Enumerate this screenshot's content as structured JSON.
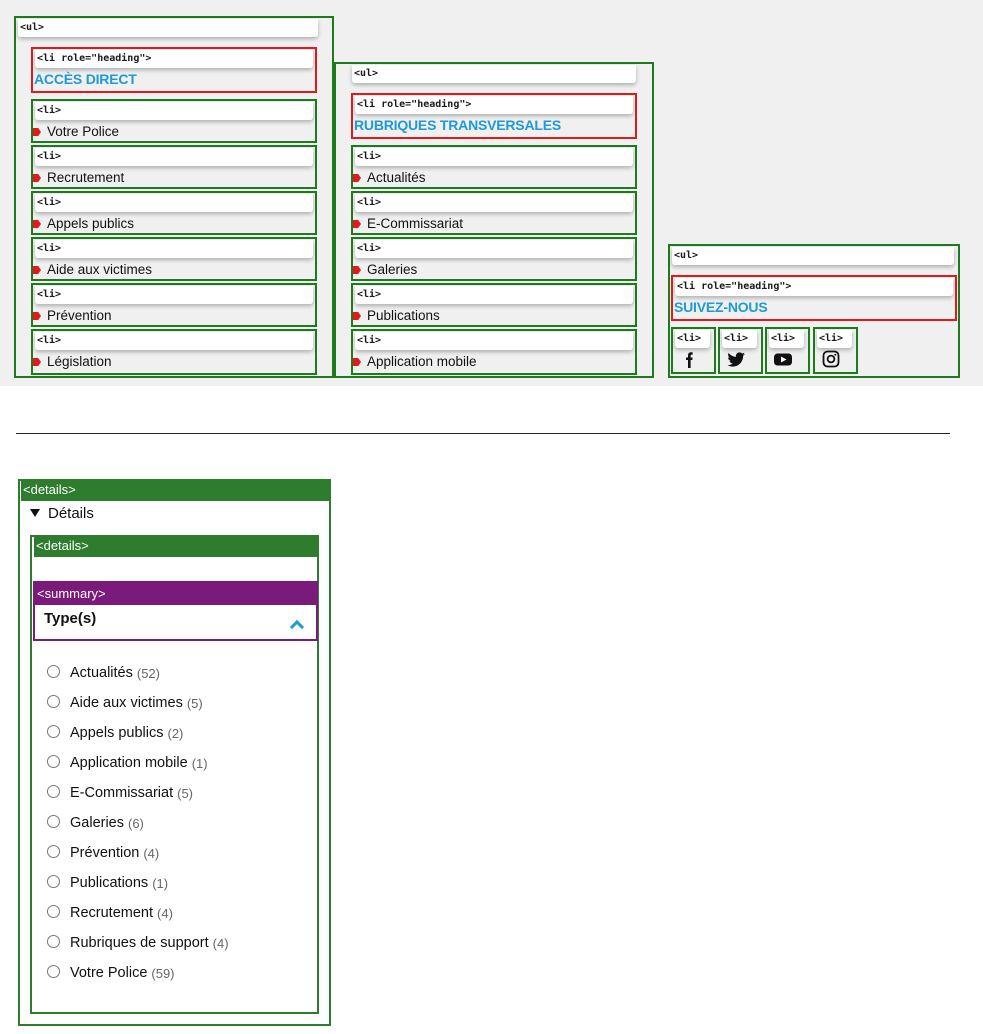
{
  "tags": {
    "ul": "<ul>",
    "li": "<li>",
    "li_heading": "<li role=\"heading\">",
    "details": "<details>",
    "summary": "<summary>"
  },
  "columns": {
    "acces_direct": {
      "heading": "ACCÈS DIRECT",
      "items": [
        "Votre Police",
        "Recrutement",
        "Appels publics",
        "Aide aux victimes",
        "Prévention",
        "Législation"
      ]
    },
    "rubriques": {
      "heading": "RUBRIQUES TRANSVERSALES",
      "items": [
        "Actualités",
        "E-Commissariat",
        "Galeries",
        "Publications",
        "Application mobile"
      ]
    },
    "suivez": {
      "heading": "SUIVEZ-NOUS",
      "icons": [
        "facebook-icon",
        "twitter-icon",
        "youtube-icon",
        "instagram-icon"
      ]
    }
  },
  "details": {
    "summary_label": "Détails",
    "filter_title": "Type(s)",
    "options": [
      {
        "label": "Actualités",
        "count": "(52)"
      },
      {
        "label": "Aide aux victimes",
        "count": "(5)"
      },
      {
        "label": "Appels publics",
        "count": "(2)"
      },
      {
        "label": "Application mobile",
        "count": "(1)"
      },
      {
        "label": "E-Commissariat",
        "count": "(5)"
      },
      {
        "label": "Galeries",
        "count": "(6)"
      },
      {
        "label": "Prévention",
        "count": "(4)"
      },
      {
        "label": "Publications",
        "count": "(1)"
      },
      {
        "label": "Recrutement",
        "count": "(4)"
      },
      {
        "label": "Rubriques de support",
        "count": "(4)"
      },
      {
        "label": "Votre Police",
        "count": "(59)"
      }
    ]
  },
  "colors": {
    "list_outline": "#1f7a1f",
    "heading_outline": "#e01b1b",
    "heading_text": "#1e9ad6",
    "details_tag": "#2e7d2e",
    "summary_tag": "#7a1a7a"
  }
}
